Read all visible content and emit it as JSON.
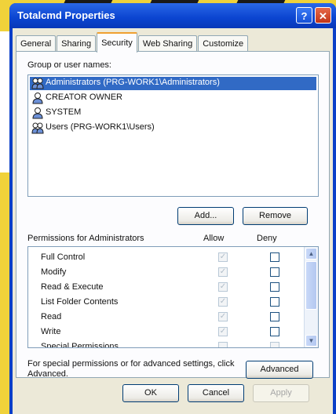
{
  "window": {
    "title": "Totalcmd Properties",
    "help_label": "?",
    "close_label": "✕"
  },
  "tabs": [
    {
      "label": "General"
    },
    {
      "label": "Sharing"
    },
    {
      "label": "Security"
    },
    {
      "label": "Web Sharing"
    },
    {
      "label": "Customize"
    }
  ],
  "groups": {
    "label": "Group or user names:",
    "items": [
      {
        "name": "Administrators (PRG-WORK1\\Administrators)",
        "selected": true
      },
      {
        "name": "CREATOR OWNER",
        "selected": false
      },
      {
        "name": "SYSTEM",
        "selected": false
      },
      {
        "name": "Users (PRG-WORK1\\Users)",
        "selected": false
      }
    ],
    "add_label": "Add...",
    "remove_label": "Remove"
  },
  "permissions": {
    "label": "Permissions for Administrators",
    "allow_header": "Allow",
    "deny_header": "Deny",
    "items": [
      {
        "name": "Full Control",
        "allow": true,
        "deny": false
      },
      {
        "name": "Modify",
        "allow": true,
        "deny": false
      },
      {
        "name": "Read & Execute",
        "allow": true,
        "deny": false
      },
      {
        "name": "List Folder Contents",
        "allow": true,
        "deny": false
      },
      {
        "name": "Read",
        "allow": true,
        "deny": false
      },
      {
        "name": "Write",
        "allow": true,
        "deny": false
      },
      {
        "name": "Special Permissions",
        "allow": false,
        "deny": false
      }
    ]
  },
  "advanced": {
    "text": "For special permissions or for advanced settings, click Advanced.",
    "button_label": "Advanced"
  },
  "footer": {
    "ok_label": "OK",
    "cancel_label": "Cancel",
    "apply_label": "Apply"
  },
  "colors": {
    "selection": "#316ac5",
    "titlebar": "#0b44d0",
    "dialog_bg": "#ece9d8"
  }
}
